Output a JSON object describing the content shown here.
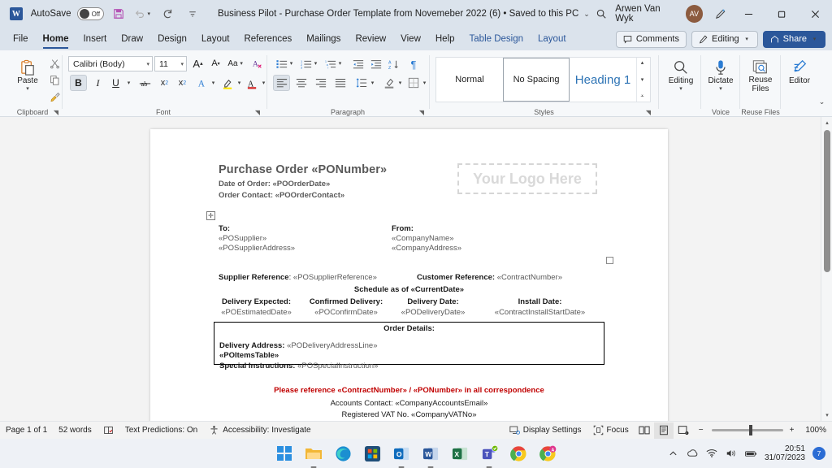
{
  "titlebar": {
    "app_icon": "word-icon",
    "autosave_label": "AutoSave",
    "autosave_state": "Off",
    "save_icon": "save-icon",
    "undo_icon": "undo-icon",
    "redo_icon": "redo-icon",
    "customize_icon": "customize-quick-access-icon",
    "document_title": "Business Pilot - Purchase Order Template from Novemeber 2022 (6)  •  Saved to this PC",
    "search_icon": "search-icon",
    "user_name": "Arwen Van Wyk",
    "user_initials": "AV",
    "pen_icon": "ink-pen-icon",
    "minimize": "minimize-icon",
    "restore": "restore-icon",
    "close": "close-icon"
  },
  "tabs": [
    {
      "label": "File",
      "active": false,
      "ctx": false
    },
    {
      "label": "Home",
      "active": true,
      "ctx": false
    },
    {
      "label": "Insert",
      "active": false,
      "ctx": false
    },
    {
      "label": "Draw",
      "active": false,
      "ctx": false
    },
    {
      "label": "Design",
      "active": false,
      "ctx": false
    },
    {
      "label": "Layout",
      "active": false,
      "ctx": false
    },
    {
      "label": "References",
      "active": false,
      "ctx": false
    },
    {
      "label": "Mailings",
      "active": false,
      "ctx": false
    },
    {
      "label": "Review",
      "active": false,
      "ctx": false
    },
    {
      "label": "View",
      "active": false,
      "ctx": false
    },
    {
      "label": "Help",
      "active": false,
      "ctx": false
    },
    {
      "label": "Table Design",
      "active": false,
      "ctx": true
    },
    {
      "label": "Layout",
      "active": false,
      "ctx": true
    }
  ],
  "tabs_right": {
    "comments_label": "Comments",
    "editing_label": "Editing",
    "share_label": "Share"
  },
  "ribbon": {
    "clipboard": {
      "group_label": "Clipboard",
      "paste_label": "Paste",
      "cut_icon": "scissors-icon",
      "copy_icon": "copy-icon",
      "format_painter_icon": "format-painter-icon"
    },
    "font": {
      "group_label": "Font",
      "font_family": "Calibri (Body)",
      "font_size": "11",
      "grow_font": "A",
      "shrink_font": "A",
      "change_case": "Aa",
      "clear_formatting_icon": "clear-formatting-icon",
      "bold": "B",
      "italic": "I",
      "underline": "U",
      "strikethrough_icon": "strikethrough-icon",
      "subscript": "x",
      "superscript": "x",
      "text_effects": "A",
      "highlight": "A",
      "font_color": "A"
    },
    "paragraph": {
      "group_label": "Paragraph",
      "bullets_icon": "bullet-list-icon",
      "numbering_icon": "numbered-list-icon",
      "multilevel_icon": "multilevel-list-icon",
      "decrease_indent_icon": "decrease-indent-icon",
      "increase_indent_icon": "increase-indent-icon",
      "sort_icon": "sort-az-icon",
      "show_marks_icon": "paragraph-marks-icon",
      "align_left_icon": "align-left-icon",
      "align_center_icon": "align-center-icon",
      "align_right_icon": "align-right-icon",
      "justify_icon": "justify-icon",
      "line_spacing_icon": "line-spacing-icon",
      "shading_icon": "shading-icon",
      "borders_icon": "borders-icon"
    },
    "styles": {
      "group_label": "Styles",
      "items": [
        {
          "label": "Normal",
          "selected": false
        },
        {
          "label": "No Spacing",
          "selected": true
        },
        {
          "label": "Heading 1",
          "selected": false
        }
      ]
    },
    "editing": {
      "label": "Editing",
      "icon": "find-magnifier-icon"
    },
    "voice": {
      "group_label": "Voice",
      "label": "Dictate",
      "icon": "microphone-icon"
    },
    "reuse": {
      "group_label": "Reuse Files",
      "label": "Reuse Files",
      "icon": "reuse-files-icon"
    },
    "editor": {
      "label": "Editor",
      "icon": "editor-pen-icon"
    },
    "collapse_icon": "collapse-ribbon-icon"
  },
  "document": {
    "title": "Purchase Order «PONumber»",
    "date_of_order": "Date of Order: «POOrderDate»",
    "order_contact": "Order Contact: «POOrderContact»",
    "logo_placeholder": "Your Logo Here",
    "to_label": "To:",
    "to_line1": "«POSupplier»",
    "to_line2": "«POSupplierAddress»",
    "from_label": "From:",
    "from_line1": "«CompanyName»",
    "from_line2": "«CompanyAddress»",
    "supplier_reference_label": "Supplier Reference",
    "supplier_reference_value": "«POSupplierReference»",
    "customer_reference_label": "Customer Reference:",
    "customer_reference_value": "«ContractNumber»",
    "schedule_line": "Schedule as of «CurrentDate»",
    "schedule_columns": [
      {
        "label": "Delivery Expected:",
        "value": "«POEstimatedDate»"
      },
      {
        "label": "Confirmed Delivery:",
        "value": "«POConfirmDate»"
      },
      {
        "label": "Delivery Date:",
        "value": "«PODeliveryDate»"
      },
      {
        "label": "Install Date:",
        "value": "«ContractInstallStartDate»"
      }
    ],
    "order_details_title": "Order Details:",
    "delivery_address_label": "Delivery Address:",
    "delivery_address_value": "«PODeliveryAddressLine»",
    "items_table": "«POItemsTable»",
    "special_instructions_label": "Special Instructions:",
    "special_instructions_value": "«POSpecialInstruction»",
    "reference_notice": "Please reference «ContractNumber» / «PONumber» in all correspondence",
    "accounts_contact": "Accounts Contact: «CompanyAccountsEmail»",
    "vat_line": "Registered VAT No. «CompanyVATNo»",
    "table_move_handle_icon": "table-move-handle-icon",
    "table_resize_handle_icon": "table-resize-handle-icon"
  },
  "statusbar": {
    "page": "Page 1 of 1",
    "words": "52 words",
    "proofing_icon": "proofing-errors-icon",
    "text_predictions": "Text Predictions: On",
    "accessibility_icon": "accessibility-icon",
    "accessibility": "Accessibility: Investigate",
    "display_settings_icon": "display-settings-icon",
    "display_settings": "Display Settings",
    "focus_icon": "focus-mode-icon",
    "focus": "Focus",
    "read_mode_icon": "read-mode-icon",
    "print_layout_icon": "print-layout-icon",
    "web_layout_icon": "web-layout-icon",
    "zoom_out": "−",
    "zoom_in": "+",
    "zoom_level": "100%"
  },
  "taskbar": {
    "apps": [
      {
        "name": "start-button",
        "glyph": "",
        "color": "#0a84d8",
        "running": false
      },
      {
        "name": "file-explorer",
        "glyph": "",
        "color": "#f7b733",
        "running": true
      },
      {
        "name": "microsoft-edge",
        "glyph": "",
        "color": "#1b8fd1",
        "running": false
      },
      {
        "name": "microsoft-store",
        "glyph": "",
        "color": "#1f4e79",
        "running": false
      },
      {
        "name": "outlook",
        "glyph": "O",
        "color": "#0f6cbd",
        "running": true
      },
      {
        "name": "word",
        "glyph": "W",
        "color": "#2b579a",
        "running": true
      },
      {
        "name": "excel",
        "glyph": "X",
        "color": "#1e7145",
        "running": false
      },
      {
        "name": "teams",
        "glyph": "T",
        "color": "#4b53bc",
        "running": true
      },
      {
        "name": "google-chrome",
        "glyph": "",
        "color": "#d94134",
        "running": false
      },
      {
        "name": "google-chrome-profile",
        "glyph": "",
        "color": "#d94134",
        "running": false
      }
    ],
    "tray": {
      "show_hidden_icon": "chevron-up-icon",
      "onedrive_icon": "onedrive-cloud-icon",
      "wifi_icon": "wifi-icon",
      "volume_icon": "speaker-icon",
      "battery_icon": "battery-icon",
      "time": "20:51",
      "date": "31/07/2023",
      "notification_count": "7"
    }
  }
}
